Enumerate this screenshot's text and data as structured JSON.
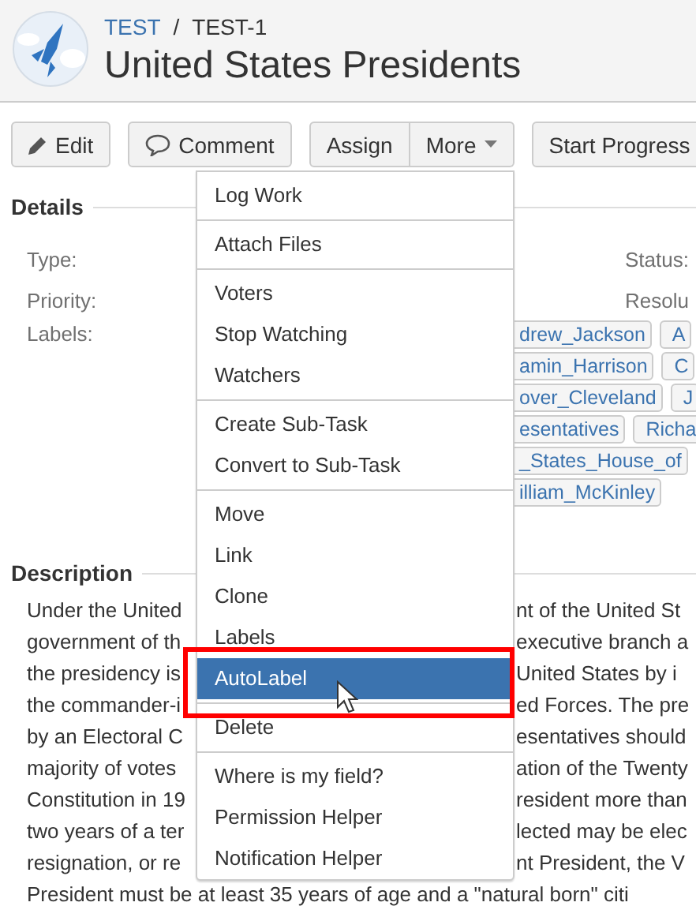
{
  "breadcrumb": {
    "project": "TEST",
    "separator": "/",
    "issue_key": "TEST-1"
  },
  "title": "United States Presidents",
  "toolbar": [
    [
      {
        "label": "Edit",
        "kind": "edit"
      }
    ],
    [
      {
        "label": "Comment",
        "kind": "comment"
      }
    ],
    [
      {
        "label": "Assign",
        "kind": "text"
      },
      {
        "label": "More",
        "kind": "dropdown"
      }
    ],
    [
      {
        "label": "Start Progress",
        "kind": "text"
      }
    ]
  ],
  "details": {
    "heading": "Details",
    "fields": [
      {
        "label": "Type:",
        "side_label": "Status:"
      },
      {
        "label": "Priority:",
        "side_label": "Resolu"
      }
    ],
    "labels": {
      "label": "Labels:",
      "rows": [
        [
          "drew_Jackson",
          "A"
        ],
        [
          "amin_Harrison",
          "C"
        ],
        [
          "over_Cleveland",
          "J"
        ],
        [
          "esentatives",
          "Richa"
        ],
        [
          "_States_House_of"
        ],
        [
          "illiam_McKinley"
        ]
      ]
    }
  },
  "description": {
    "heading": "Description",
    "lines": [
      {
        "left": "Under the United",
        "right": "nt of the United St"
      },
      {
        "left": "government of th",
        "right": "executive branch a"
      },
      {
        "left": "the presidency is",
        "right": "United States by i"
      },
      {
        "left": "the commander-i",
        "right": "ed Forces. The pre"
      },
      {
        "left": "by an Electoral C",
        "right": "esentatives should"
      },
      {
        "left": "majority of votes",
        "right": "ation of the Twenty"
      },
      {
        "left": "Constitution in 19",
        "right": "resident more than"
      },
      {
        "left": "two years of a ter",
        "right": "lected may be elec"
      },
      {
        "left": "resignation, or re",
        "right": "nt President, the V"
      },
      {
        "left": "President must be at least 35 years of age and a \"natural born\" citi"
      }
    ]
  },
  "menu": [
    [
      {
        "label": "Log Work",
        "selected": false
      }
    ],
    [
      {
        "label": "Attach Files",
        "selected": false
      }
    ],
    [
      {
        "label": "Voters",
        "selected": false
      },
      {
        "label": "Stop Watching",
        "selected": false
      },
      {
        "label": "Watchers",
        "selected": false
      }
    ],
    [
      {
        "label": "Create Sub-Task",
        "selected": false
      },
      {
        "label": "Convert to Sub-Task",
        "selected": false
      }
    ],
    [
      {
        "label": "Move",
        "selected": false
      },
      {
        "label": "Link",
        "selected": false
      },
      {
        "label": "Clone",
        "selected": false
      },
      {
        "label": "Labels",
        "selected": false
      },
      {
        "label": "AutoLabel",
        "selected": true
      }
    ],
    [
      {
        "label": "Delete",
        "selected": false
      }
    ],
    [
      {
        "label": "Where is my field?",
        "selected": false
      },
      {
        "label": "Permission Helper",
        "selected": false
      },
      {
        "label": "Notification Helper",
        "selected": false
      }
    ]
  ]
}
